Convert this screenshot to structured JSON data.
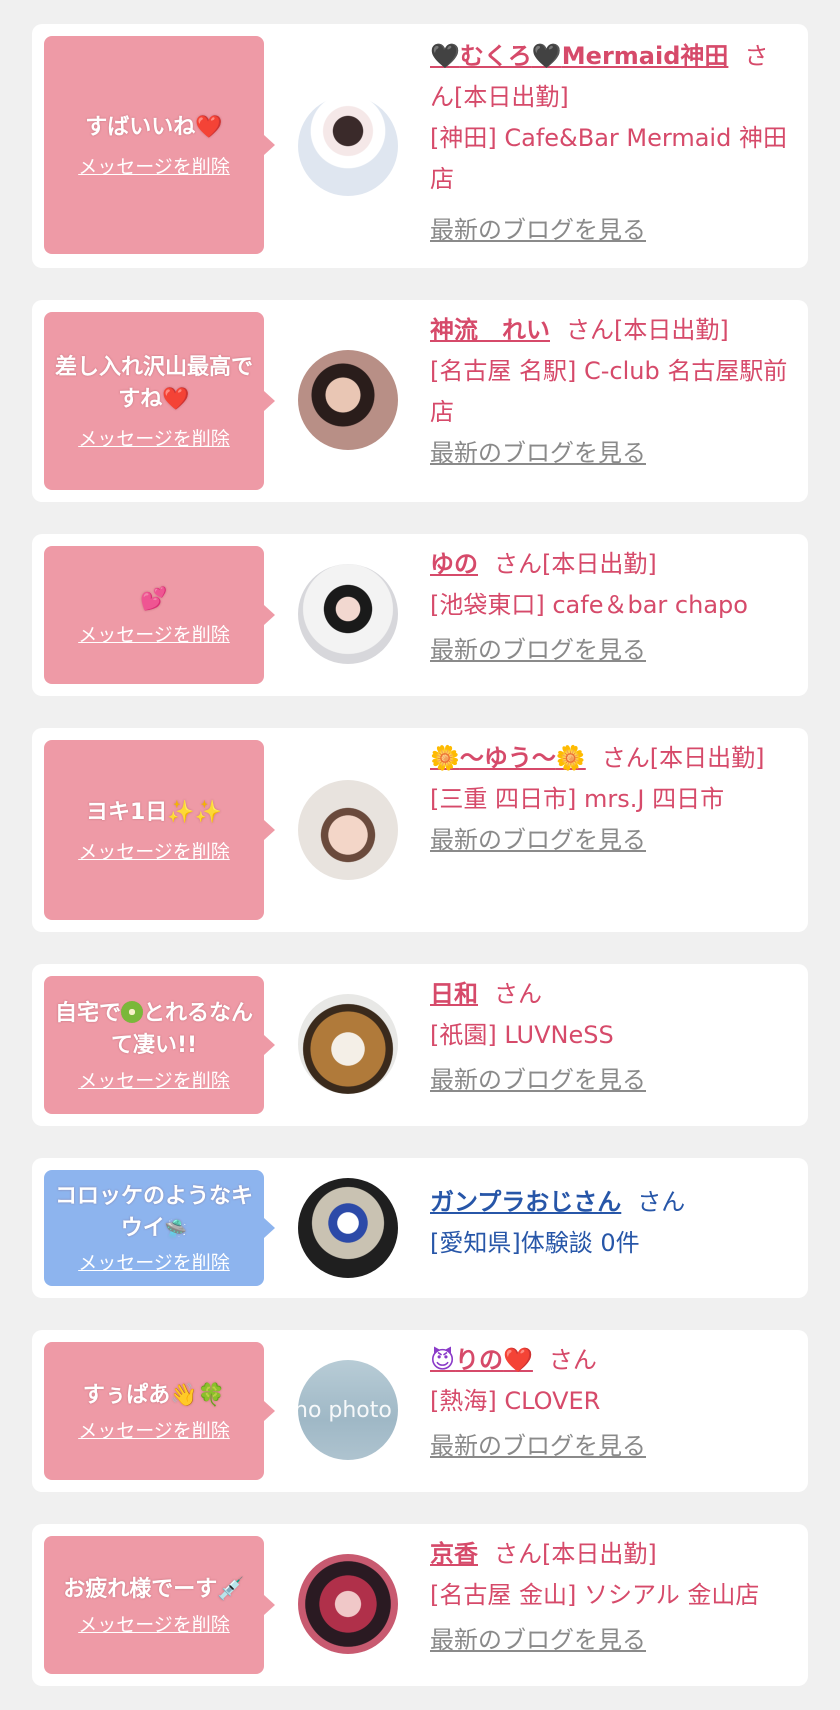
{
  "delete_label": "メッセージを削除",
  "blog_label": "最新のブログを見る",
  "san_label": "さん",
  "working_today": "[本日出勤]",
  "items": [
    {
      "message": "すばいいね",
      "message_emoji": "❤️",
      "name_prefix_emoji": "🖤",
      "name": "むくろ",
      "name_mid_emoji": "🖤",
      "name_suffix": "Mermaid神田",
      "shop": "[神田] Cafe&Bar Mermaid 神田店",
      "working_today": true,
      "avatar_icon": "avatar-photo"
    },
    {
      "message": "差し入れ沢山最高ですね",
      "message_emoji": "❤️",
      "name": "神流　れい",
      "shop": "[名古屋 名駅] C-club 名古屋駅前店",
      "working_today": true,
      "avatar_icon": "avatar-photo"
    },
    {
      "message": "",
      "message_emoji": "💕",
      "name": "ゆの",
      "shop": "[池袋東口] cafe＆bar chapo",
      "working_today": true,
      "avatar_icon": "avatar-photo"
    },
    {
      "message": "ヨキ1日",
      "message_emoji": "✨✨",
      "name_prefix_emoji": "🌼",
      "name": "～ゆう～",
      "name_suffix_emoji": "🌼",
      "shop": "[三重 四日市] mrs.J 四日市",
      "working_today": true,
      "avatar_icon": "avatar-photo"
    },
    {
      "message_part1": "自宅で",
      "message_emoji": "🥝",
      "message_part2": "とれるなんて凄い!!",
      "name": "日和",
      "shop": "[祇園] LUVNeSS",
      "working_today": false,
      "avatar_icon": "avatar-photo"
    },
    {
      "message": "コロッケのようなキウイ",
      "message_emoji": "🛸",
      "name": "ガンプラおじさん",
      "shop": "[愛知県]体験談 0件",
      "working_today": false,
      "avatar_icon": "avatar-photo"
    },
    {
      "message": "すぅぱあ",
      "message_emoji": "👋🍀",
      "name_prefix_emoji": "😈",
      "name": "りの",
      "name_suffix_emoji": "❤️",
      "shop": "[熱海] CLOVER",
      "working_today": false,
      "avatar_text": "no photo",
      "avatar_icon": "no-photo"
    },
    {
      "message": "お疲れ様でーす",
      "message_emoji": "💉",
      "name": "京香",
      "shop": "[名古屋 金山] ソシアル 金山店",
      "working_today": true,
      "avatar_icon": "avatar-photo"
    }
  ],
  "colors": {
    "bubble_pink": "#ee9aa6",
    "bubble_blue": "#8db4ee",
    "name_pink": "#d64a6a",
    "name_blue": "#2756a8",
    "link_gray": "#8a8a8a",
    "background": "#f0f0f0"
  }
}
